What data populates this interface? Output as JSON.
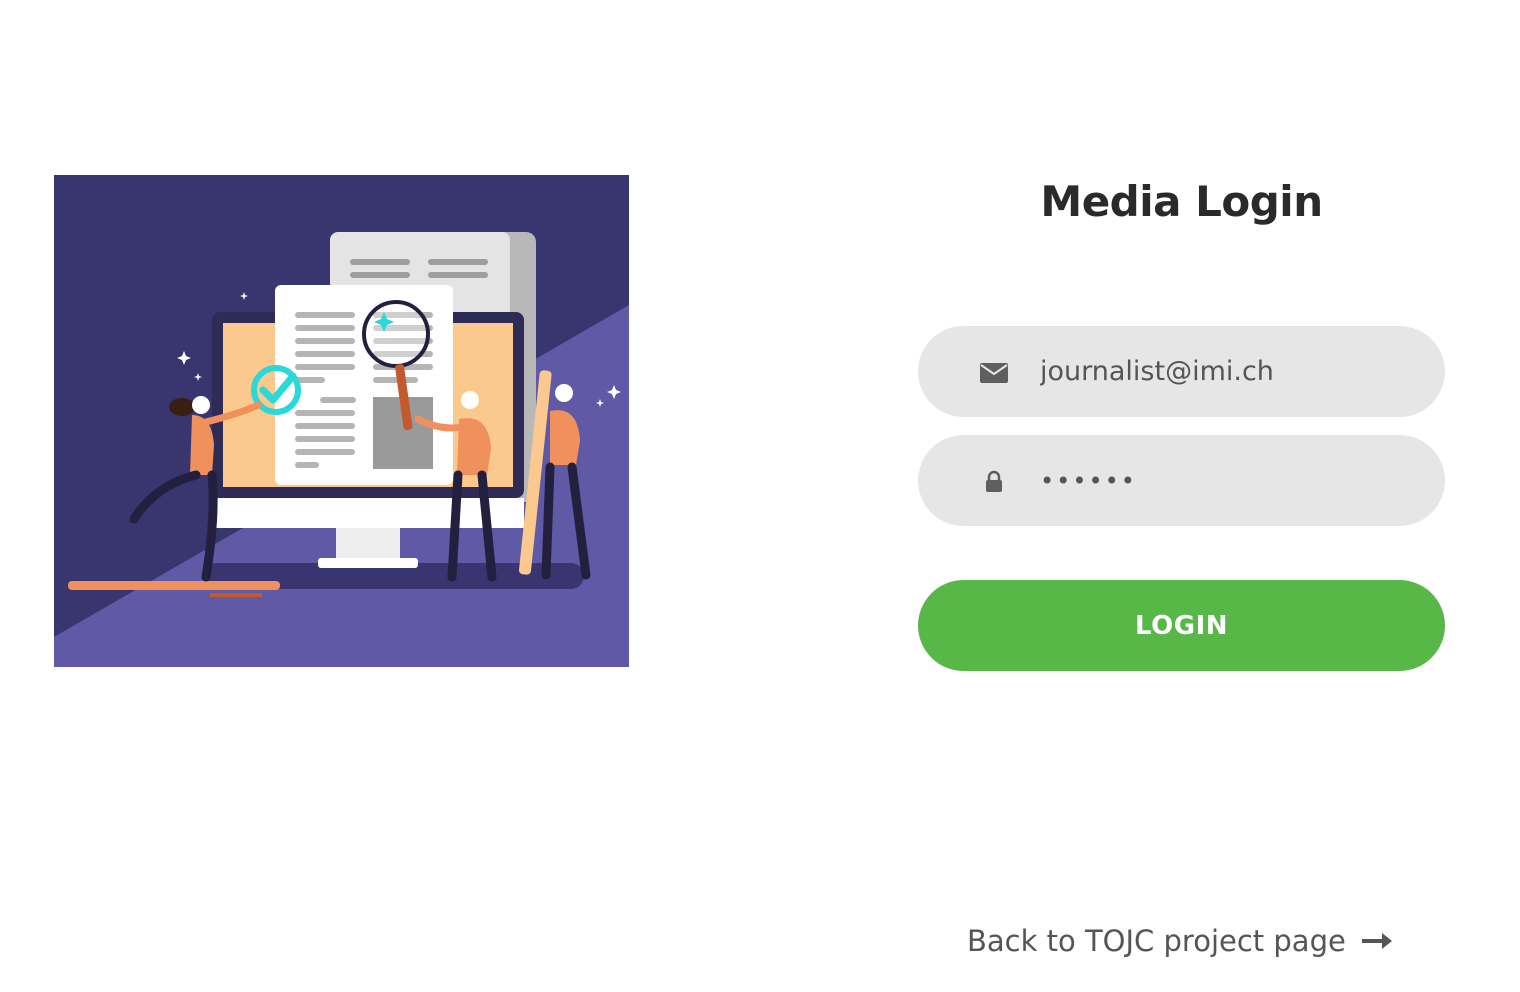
{
  "title": "Media Login",
  "email": {
    "value": "journalist@imi.ch",
    "icon": "envelope-icon"
  },
  "password": {
    "value": "••••••",
    "icon": "lock-icon"
  },
  "login_button": {
    "label": "LOGIN",
    "color": "#57b747"
  },
  "back_link": {
    "label": "Back to TOJC project page",
    "icon": "arrow-right-icon"
  },
  "colors": {
    "field_background": "#e6e6e6",
    "illustration_dark": "#39356f",
    "illustration_light": "#605aa6",
    "accent_orange": "#f0905c"
  }
}
